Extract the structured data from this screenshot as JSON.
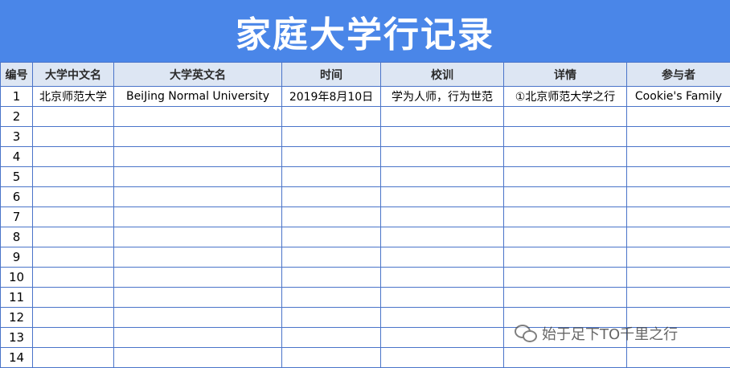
{
  "title": "家庭大学行记录",
  "columns": [
    "编号",
    "大学中文名",
    "大学英文名",
    "时间",
    "校训",
    "详情",
    "参与者"
  ],
  "rows": [
    [
      "1",
      "北京师范大学",
      "BeiJing Normal University",
      "2019年8月10日",
      "学为人师，行为世范",
      "①北京师范大学之行",
      "Cookie's Family"
    ],
    [
      "2",
      "",
      "",
      "",
      "",
      "",
      ""
    ],
    [
      "3",
      "",
      "",
      "",
      "",
      "",
      ""
    ],
    [
      "4",
      "",
      "",
      "",
      "",
      "",
      ""
    ],
    [
      "5",
      "",
      "",
      "",
      "",
      "",
      ""
    ],
    [
      "6",
      "",
      "",
      "",
      "",
      "",
      ""
    ],
    [
      "7",
      "",
      "",
      "",
      "",
      "",
      ""
    ],
    [
      "8",
      "",
      "",
      "",
      "",
      "",
      ""
    ],
    [
      "9",
      "",
      "",
      "",
      "",
      "",
      ""
    ],
    [
      "10",
      "",
      "",
      "",
      "",
      "",
      ""
    ],
    [
      "11",
      "",
      "",
      "",
      "",
      "",
      ""
    ],
    [
      "12",
      "",
      "",
      "",
      "",
      "",
      ""
    ],
    [
      "13",
      "",
      "",
      "",
      "",
      "",
      ""
    ],
    [
      "14",
      "",
      "",
      "",
      "",
      "",
      ""
    ]
  ],
  "watermark": "始于足下TO千里之行",
  "colors": {
    "header_bg": "#4a86e8",
    "column_header_bg": "#dde6f3",
    "grid": "#4a74c9"
  }
}
